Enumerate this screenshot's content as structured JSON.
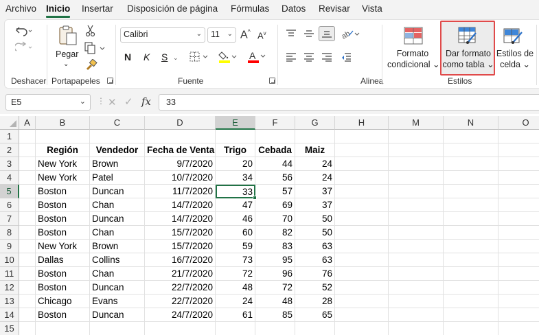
{
  "tabs": [
    "Archivo",
    "Inicio",
    "Insertar",
    "Disposición de página",
    "Fórmulas",
    "Datos",
    "Revisar",
    "Vista"
  ],
  "active_tab": "Inicio",
  "ribbon": {
    "groups": {
      "undo": "Deshacer",
      "clipboard": "Portapapeles",
      "font": "Fuente",
      "alignment": "Alinea",
      "styles": "Estilos"
    },
    "paste_label": "Pegar",
    "font_name": "Calibri",
    "font_size": "11",
    "bold": "N",
    "italic": "K",
    "underline": "S",
    "grow_font": "A",
    "shrink_font": "A",
    "font_color_glyph": "A",
    "conditional_format": [
      "Formato",
      "condicional"
    ],
    "format_as_table": [
      "Dar formato",
      "como tabla"
    ],
    "cell_styles": [
      "Estilos de",
      "celda"
    ],
    "accent_colors": {
      "highlight": "#ffff00",
      "font": "#ff0000",
      "border": "#e04a4a",
      "excel_green": "#217346"
    }
  },
  "formula_bar": {
    "name_box": "E5",
    "fx": "fx",
    "value": "33"
  },
  "columns": [
    "A",
    "B",
    "C",
    "D",
    "E",
    "F",
    "G",
    "H",
    "M",
    "N",
    "O"
  ],
  "rows": [
    "1",
    "2",
    "3",
    "4",
    "5",
    "6",
    "7",
    "8",
    "9",
    "10",
    "11",
    "12",
    "13",
    "14",
    "15"
  ],
  "selected": {
    "column": "E",
    "row": "5"
  },
  "table": {
    "headers": [
      "Región",
      "Vendedor",
      "Fecha de Venta",
      "Trigo",
      "Cebada",
      "Maiz"
    ],
    "rows": [
      [
        "New York",
        "Brown",
        "9/7/2020",
        "20",
        "44",
        "24"
      ],
      [
        "New York",
        "Patel",
        "10/7/2020",
        "34",
        "56",
        "24"
      ],
      [
        "Boston",
        "Duncan",
        "11/7/2020",
        "33",
        "57",
        "37"
      ],
      [
        "Boston",
        "Chan",
        "14/7/2020",
        "47",
        "69",
        "37"
      ],
      [
        "Boston",
        "Duncan",
        "14/7/2020",
        "46",
        "70",
        "50"
      ],
      [
        "Boston",
        "Chan",
        "15/7/2020",
        "60",
        "82",
        "50"
      ],
      [
        "New York",
        "Brown",
        "15/7/2020",
        "59",
        "83",
        "63"
      ],
      [
        "Dallas",
        "Collins",
        "16/7/2020",
        "73",
        "95",
        "63"
      ],
      [
        "Boston",
        "Chan",
        "21/7/2020",
        "72",
        "96",
        "76"
      ],
      [
        "Boston",
        "Duncan",
        "22/7/2020",
        "48",
        "72",
        "52"
      ],
      [
        "Chicago",
        "Evans",
        "22/7/2020",
        "24",
        "48",
        "28"
      ],
      [
        "Boston",
        "Duncan",
        "24/7/2020",
        "61",
        "85",
        "65"
      ]
    ]
  }
}
